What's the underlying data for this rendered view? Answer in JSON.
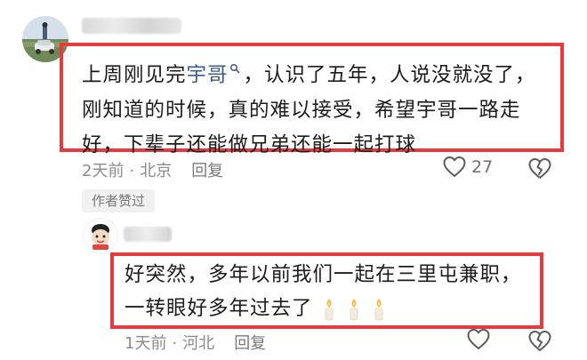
{
  "comment": {
    "text_before": "上周刚见完",
    "mention": "宇哥",
    "text_after": "，认识了五年，人说没就没了，刚知道的时候，真的难以接受，希望宇哥一路走好，下辈子还能做兄弟还能一起打球",
    "time": "2天前",
    "location": "北京",
    "separator": "·",
    "reply_label": "回复",
    "like_count": "27",
    "author_liked_tag": "作者赞过"
  },
  "reply": {
    "text": "好突然，多年以前我们一起在三里屯兼职，一转眼好多年过去了",
    "candles": [
      "candle",
      "candle",
      "candle"
    ],
    "time": "1天前",
    "location": "河北",
    "separator": "·",
    "reply_label": "回复"
  },
  "colors": {
    "highlight_border": "#e8393e",
    "mention_link": "#3b5c8f",
    "meta_text": "#8b8b8b"
  }
}
